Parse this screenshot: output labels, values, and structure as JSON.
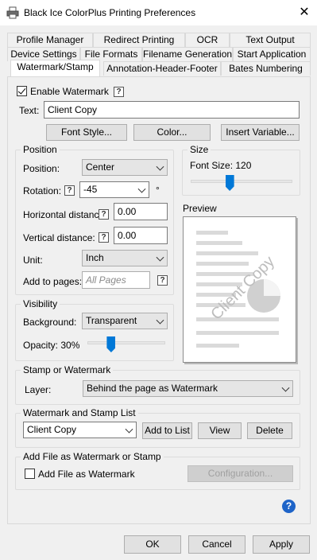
{
  "window": {
    "title": "Black Ice ColorPlus Printing Preferences"
  },
  "tabs": {
    "row1": [
      "Profile Manager",
      "Redirect Printing",
      "OCR",
      "Text Output"
    ],
    "row2": [
      "Device Settings",
      "File Formats",
      "Filename Generation",
      "Start Application"
    ],
    "row3": [
      "Watermark/Stamp",
      "Annotation-Header-Footer",
      "Bates Numbering"
    ]
  },
  "watermark": {
    "enable_label": "Enable Watermark",
    "enabled": true,
    "help": "?",
    "text_label": "Text:",
    "text_value": "Client Copy",
    "font_style_label": "Font Style...",
    "color_label": "Color...",
    "insert_variable_label": "Insert Variable..."
  },
  "position": {
    "group_label": "Position",
    "position_label": "Position:",
    "position_value": "Center",
    "rotation_label": "Rotation:",
    "rotation_value": "-45",
    "rotation_unit": "°",
    "hdist_label": "Horizontal distance:",
    "hdist_value": "0.00",
    "vdist_label": "Vertical distance:",
    "vdist_value": "0.00",
    "unit_label": "Unit:",
    "unit_value": "Inch",
    "pages_label": "Add to pages:",
    "pages_placeholder": "All Pages"
  },
  "size": {
    "group_label": "Size",
    "font_size_label": "Font Size: 120",
    "font_size_value": 120,
    "slider_fraction": 0.38
  },
  "preview": {
    "label": "Preview",
    "watermark_text": "Client Copy"
  },
  "visibility": {
    "group_label": "Visibility",
    "background_label": "Background:",
    "background_value": "Transparent",
    "opacity_label": "Opacity: 30%",
    "opacity_value": 30,
    "slider_fraction": 0.3
  },
  "stamp": {
    "group_label": "Stamp or Watermark",
    "layer_label": "Layer:",
    "layer_value": "Behind the page as Watermark"
  },
  "list": {
    "group_label": "Watermark and Stamp List",
    "selected": "Client Copy",
    "add_label": "Add to List",
    "view_label": "View",
    "delete_label": "Delete"
  },
  "addfile": {
    "group_label": "Add File as Watermark or Stamp",
    "checkbox_label": "Add File as Watermark",
    "checked": false,
    "config_label": "Configuration..."
  },
  "footer": {
    "ok_label": "OK",
    "cancel_label": "Cancel",
    "apply_label": "Apply",
    "help_icon": "?"
  },
  "colors": {
    "accent": "#0078d7",
    "help_icon": "#1e64c8"
  }
}
